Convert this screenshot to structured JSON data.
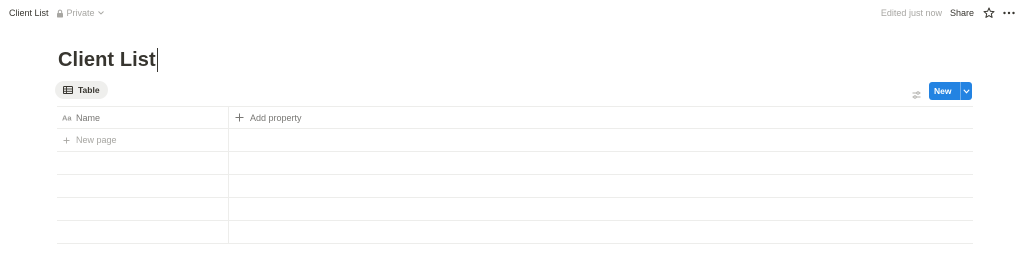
{
  "topbar": {
    "page_title": "Client List",
    "privacy_label": "Private",
    "edited_label": "Edited just now",
    "share_label": "Share"
  },
  "page": {
    "title": "Client List"
  },
  "view": {
    "tab_label": "Table"
  },
  "toolbar": {
    "new_label": "New"
  },
  "table": {
    "columns": [
      {
        "label": "Name",
        "icon": "text-property-icon"
      },
      {
        "label": "Add property",
        "icon": "plus-icon"
      }
    ],
    "new_page_label": "New page"
  },
  "colors": {
    "accent": "#2383e2",
    "text": "#37352f",
    "muted": "#a7a6a2",
    "border": "#ededeb"
  }
}
